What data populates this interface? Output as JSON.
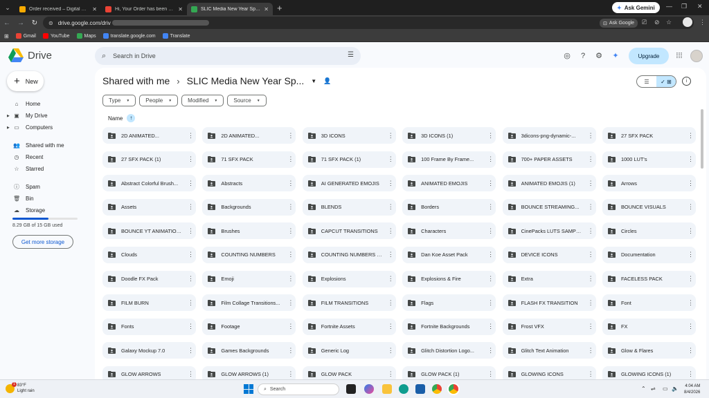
{
  "browser": {
    "tabs": [
      {
        "title": "Order received – Digital Produ",
        "active": false,
        "favicon_color": "#f9ab00"
      },
      {
        "title": "Hi, Your Order has been Comp",
        "active": false,
        "favicon_color": "#ea4335"
      },
      {
        "title": "SLIC Media New Year Special P",
        "active": true,
        "favicon_color": "#34a853"
      }
    ],
    "new_tab_label": "+",
    "ask_gemini_label": "Ask Gemini",
    "url": "drive.google.com/driv",
    "ask_google_label": "Ask Google",
    "bookmarks": [
      {
        "label": "Gmail",
        "color": "#ea4335"
      },
      {
        "label": "YouTube",
        "color": "#ff0000"
      },
      {
        "label": "Maps",
        "color": "#34a853"
      },
      {
        "label": "translate.google.com",
        "color": "#4285f4"
      },
      {
        "label": "Translate",
        "color": "#4285f4"
      }
    ]
  },
  "app": {
    "name": "Drive",
    "search_placeholder": "Search in Drive",
    "upgrade_label": "Upgrade",
    "new_label": "New"
  },
  "sidebar": {
    "items": [
      {
        "label": "Home",
        "icon": "home-icon"
      },
      {
        "label": "My Drive",
        "icon": "my-drive-icon",
        "expandable": true
      },
      {
        "label": "Computers",
        "icon": "computers-icon",
        "expandable": true
      },
      {
        "label": "Shared with me",
        "icon": "shared-icon"
      },
      {
        "label": "Recent",
        "icon": "recent-icon"
      },
      {
        "label": "Starred",
        "icon": "star-icon"
      },
      {
        "label": "Spam",
        "icon": "spam-icon"
      },
      {
        "label": "Bin",
        "icon": "bin-icon"
      },
      {
        "label": "Storage",
        "icon": "storage-icon"
      }
    ],
    "storage_used_fraction": 0.55,
    "storage_text": "8.29 GB of 15 GB used",
    "get_storage_label": "Get more storage"
  },
  "main": {
    "breadcrumb_root": "Shared with me",
    "breadcrumb_current": "SLIC Media New Year Sp...",
    "filters": [
      "Type",
      "People",
      "Modified",
      "Source"
    ],
    "sort_label": "Name",
    "folders": [
      "2D ANIMATED...",
      "2D ANIMATED...",
      "3D ICONS",
      "3D ICONS (1)",
      "3dicons-png-dynamic-...",
      "27 SFX PACK",
      "27 SFX PACK (1)",
      "71 SFX PACK",
      "71 SFX PACK (1)",
      "100 Frame By Frame...",
      "700+ PAPER ASSETS",
      "1000 LUT's",
      "Abstract Colorful Brush...",
      "Abstracts",
      "AI GENERATED EMOJIS",
      "ANIMATED EMOJIS",
      "ANIMATED EMOJIS (1)",
      "Arrows",
      "Assets",
      "Backgrounds",
      "BLENDS",
      "Borders",
      "BOUNCE STREAMING...",
      "BOUNCE VISUALS",
      "BOUNCE YT ANIMATIONS",
      "Brushes",
      "CAPCUT TRANSITIONS",
      "Characters",
      "CinePacks LUTS SAMPLE",
      "Circles",
      "Clouds",
      "COUNTING NUMBERS",
      "COUNTING NUMBERS (1)",
      "Dan Koe Asset Pack",
      "DEVICE ICONS",
      "Documentation",
      "Doodle FX Pack",
      "Emoji",
      "Explosions",
      "Explosions & Fire",
      "Extra",
      "FACELESS PACK",
      "FILM BURN",
      "Film Collage Transitions...",
      "FILM TRANSITIONS",
      "Flags",
      "FLASH FX TRANSITION",
      "Font",
      "Fonts",
      "Footage",
      "Fortnite Assets",
      "Fortnite Backgrounds",
      "Frost VFX",
      "FX",
      "Galaxy Mockup 7.0",
      "Games Backgrounds",
      "Generic Log",
      "Glitch Distortion Logo...",
      "Glitch Text Animation",
      "Glow & Flares",
      "GLOW ARROWS",
      "GLOW ARROWS (1)",
      "GLOW PACK",
      "GLOW PACK (1)",
      "GLOWING ICONS",
      "GLOWING ICONS (1)"
    ]
  },
  "taskbar": {
    "temperature": "83°F",
    "weather": "Light rain",
    "weather_badge": "1",
    "search_label": "Search",
    "time": "4:04 AM",
    "date": "8/4/2026"
  }
}
